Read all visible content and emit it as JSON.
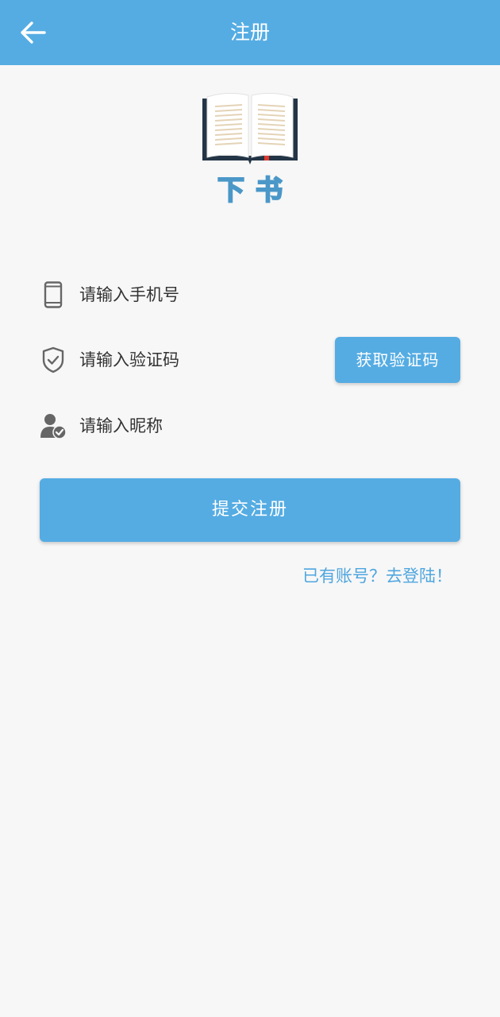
{
  "appbar": {
    "title": "注册"
  },
  "logo": {
    "text": "下书"
  },
  "form": {
    "phone_label": "请输入手机号",
    "code_label": "请输入验证码",
    "nickname_label": "请输入昵称",
    "get_code_label": "获取验证码",
    "submit_label": "提交注册"
  },
  "footer": {
    "login_link": "已有账号？去登陆！"
  },
  "colors": {
    "accent": "#55ace3",
    "background": "#f7f7f7",
    "link": "#4fa6df"
  },
  "icons": {
    "back": "arrow-left-icon",
    "phone": "phone-icon",
    "code": "shield-check-icon",
    "nickname": "user-check-icon",
    "logo": "open-book-icon"
  }
}
